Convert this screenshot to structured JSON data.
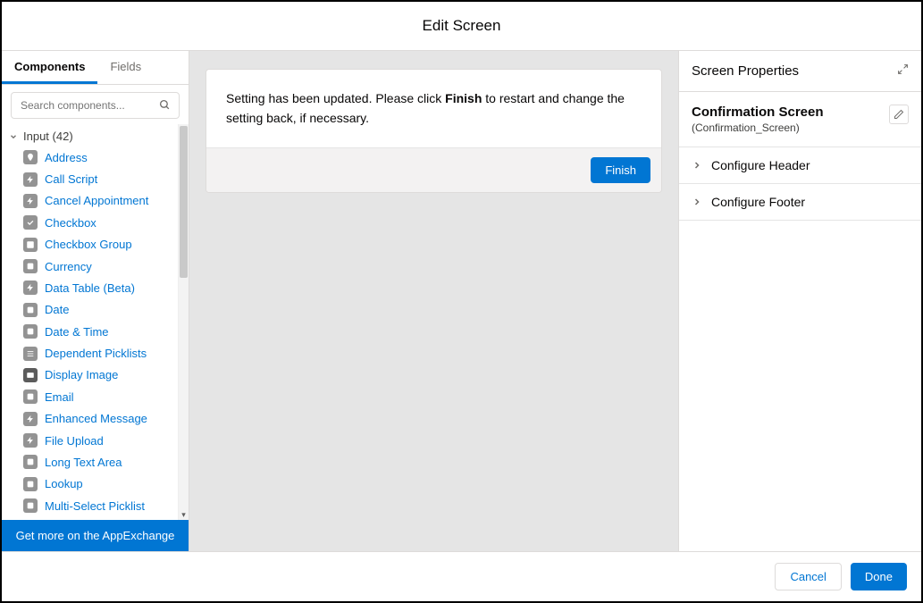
{
  "header": {
    "title": "Edit Screen"
  },
  "tabs": {
    "components": "Components",
    "fields": "Fields",
    "active": "components"
  },
  "search": {
    "placeholder": "Search components..."
  },
  "category": {
    "label": "Input (42)"
  },
  "components": [
    {
      "label": "Address"
    },
    {
      "label": "Call Script"
    },
    {
      "label": "Cancel Appointment"
    },
    {
      "label": "Checkbox"
    },
    {
      "label": "Checkbox Group"
    },
    {
      "label": "Currency"
    },
    {
      "label": "Data Table (Beta)"
    },
    {
      "label": "Date"
    },
    {
      "label": "Date & Time"
    },
    {
      "label": "Dependent Picklists"
    },
    {
      "label": "Display Image"
    },
    {
      "label": "Email"
    },
    {
      "label": "Enhanced Message"
    },
    {
      "label": "File Upload"
    },
    {
      "label": "Long Text Area"
    },
    {
      "label": "Lookup"
    },
    {
      "label": "Multi-Select Picklist"
    }
  ],
  "appexchange": {
    "label": "Get more on the AppExchange"
  },
  "canvas": {
    "message_pre": "Setting has been updated. Please click ",
    "message_bold": "Finish",
    "message_post": " to restart and change the setting back, if necessary.",
    "finish_btn": "Finish"
  },
  "props": {
    "title": "Screen Properties",
    "screen_label": "Confirmation Screen",
    "screen_api": "(Confirmation_Screen)",
    "acc_header": "Configure Header",
    "acc_footer": "Configure Footer"
  },
  "footer": {
    "cancel": "Cancel",
    "done": "Done"
  }
}
